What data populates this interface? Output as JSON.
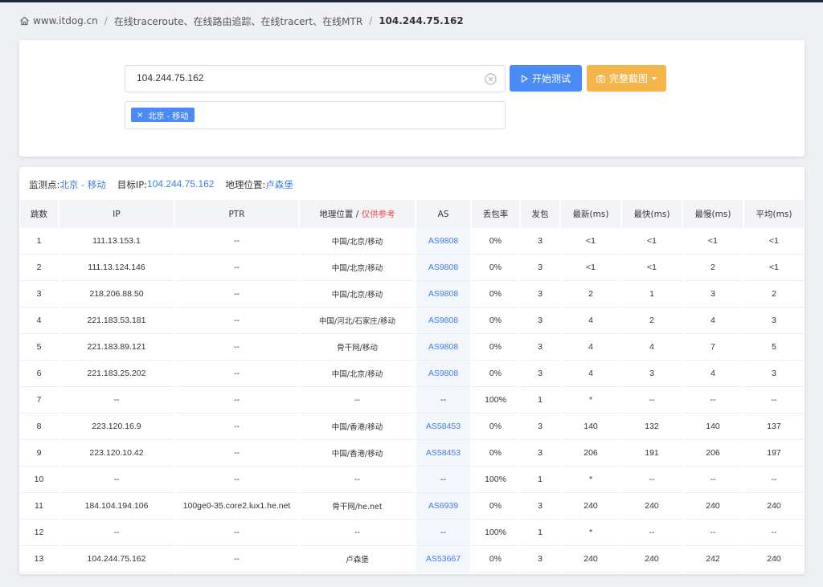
{
  "breadcrumb": {
    "site": "www.itdog.cn",
    "section": "在线traceroute、在线路由追踪、在线tracert、在线MTR",
    "current": "104.244.75.162"
  },
  "search": {
    "value": "104.244.75.162",
    "start_label": "开始测试",
    "screenshot_label": "完整截图",
    "tag_label": "北京 - 移动",
    "tag_remove": "×"
  },
  "info": {
    "monitor_label": "监测点:",
    "monitor_value": "北京 - 移动",
    "target_label": "目标IP:",
    "target_value": "104.244.75.162",
    "geo_label": "地理位置:",
    "geo_value": "卢森堡"
  },
  "table": {
    "headers": {
      "hop": "跳数",
      "ip": "IP",
      "ptr": "PTR",
      "geo": "地理位置 /",
      "geo_ref": "仅供参考",
      "as": "AS",
      "loss": "丢包率",
      "sent": "发包",
      "last": "最新(ms)",
      "best": "最快(ms)",
      "worst": "最慢(ms)",
      "avg": "平均(ms)"
    },
    "rows": [
      {
        "hop": "1",
        "ip": "111.13.153.1",
        "ptr": "--",
        "geo": "中国/北京/移动",
        "as": "AS9808",
        "loss": "0%",
        "sent": "3",
        "last": "<1",
        "best": "<1",
        "worst": "<1",
        "avg": "<1"
      },
      {
        "hop": "2",
        "ip": "111.13.124.146",
        "ptr": "--",
        "geo": "中国/北京/移动",
        "as": "AS9808",
        "loss": "0%",
        "sent": "3",
        "last": "<1",
        "best": "<1",
        "worst": "2",
        "avg": "<1"
      },
      {
        "hop": "3",
        "ip": "218.206.88.50",
        "ptr": "--",
        "geo": "中国/北京/移动",
        "as": "AS9808",
        "loss": "0%",
        "sent": "3",
        "last": "2",
        "best": "1",
        "worst": "3",
        "avg": "2"
      },
      {
        "hop": "4",
        "ip": "221.183.53.181",
        "ptr": "--",
        "geo": "中国/河北/石家庄/移动",
        "as": "AS9808",
        "loss": "0%",
        "sent": "3",
        "last": "4",
        "best": "2",
        "worst": "4",
        "avg": "3"
      },
      {
        "hop": "5",
        "ip": "221.183.89.121",
        "ptr": "--",
        "geo": "骨干网/移动",
        "as": "AS9808",
        "loss": "0%",
        "sent": "3",
        "last": "4",
        "best": "4",
        "worst": "7",
        "avg": "5"
      },
      {
        "hop": "6",
        "ip": "221.183.25.202",
        "ptr": "--",
        "geo": "中国/北京/移动",
        "as": "AS9808",
        "loss": "0%",
        "sent": "3",
        "last": "4",
        "best": "3",
        "worst": "4",
        "avg": "3"
      },
      {
        "hop": "7",
        "ip": "--",
        "ptr": "--",
        "geo": "--",
        "as": "--",
        "loss": "100%",
        "sent": "1",
        "last": "*",
        "best": "--",
        "worst": "--",
        "avg": "--"
      },
      {
        "hop": "8",
        "ip": "223.120.16.9",
        "ptr": "--",
        "geo": "中国/香港/移动",
        "as": "AS58453",
        "loss": "0%",
        "sent": "3",
        "last": "140",
        "best": "132",
        "worst": "140",
        "avg": "137"
      },
      {
        "hop": "9",
        "ip": "223.120.10.42",
        "ptr": "--",
        "geo": "中国/香港/移动",
        "as": "AS58453",
        "loss": "0%",
        "sent": "3",
        "last": "206",
        "best": "191",
        "worst": "206",
        "avg": "197"
      },
      {
        "hop": "10",
        "ip": "--",
        "ptr": "--",
        "geo": "--",
        "as": "--",
        "loss": "100%",
        "sent": "1",
        "last": "*",
        "best": "--",
        "worst": "--",
        "avg": "--"
      },
      {
        "hop": "11",
        "ip": "184.104.194.106",
        "ptr": "100ge0-35.core2.lux1.he.net",
        "geo": "骨干网/he.net",
        "as": "AS6939",
        "loss": "0%",
        "sent": "3",
        "last": "240",
        "best": "240",
        "worst": "240",
        "avg": "240"
      },
      {
        "hop": "12",
        "ip": "--",
        "ptr": "--",
        "geo": "--",
        "as": "--",
        "loss": "100%",
        "sent": "1",
        "last": "*",
        "best": "--",
        "worst": "--",
        "avg": "--"
      },
      {
        "hop": "13",
        "ip": "104.244.75.162",
        "ptr": "--",
        "geo": "卢森堡",
        "as": "AS53667",
        "loss": "0%",
        "sent": "3",
        "last": "240",
        "best": "240",
        "worst": "242",
        "avg": "240"
      }
    ]
  }
}
